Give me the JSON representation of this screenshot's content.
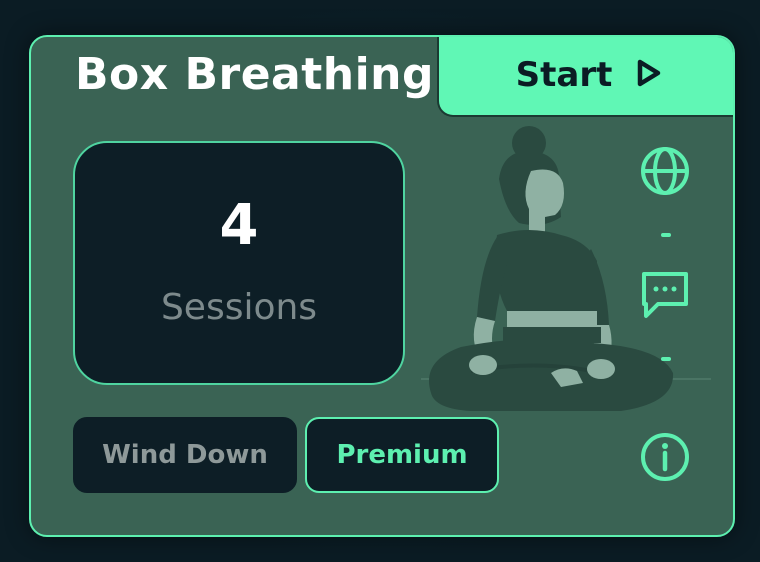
{
  "card": {
    "title": "Box Breathing",
    "start_label": "Start",
    "sessions": {
      "count": "4",
      "label": "Sessions"
    },
    "tags": [
      {
        "label": "Wind Down"
      },
      {
        "label": "Premium"
      }
    ],
    "side_icons": [
      "globe-icon",
      "chat-icon",
      "info-icon"
    ],
    "illustration": "meditating-person-illustration"
  },
  "colors": {
    "card_bg": "#3a6354",
    "accent": "#60f7b5",
    "dark": "#0d1e26",
    "page_bg": "#0b1c24"
  }
}
